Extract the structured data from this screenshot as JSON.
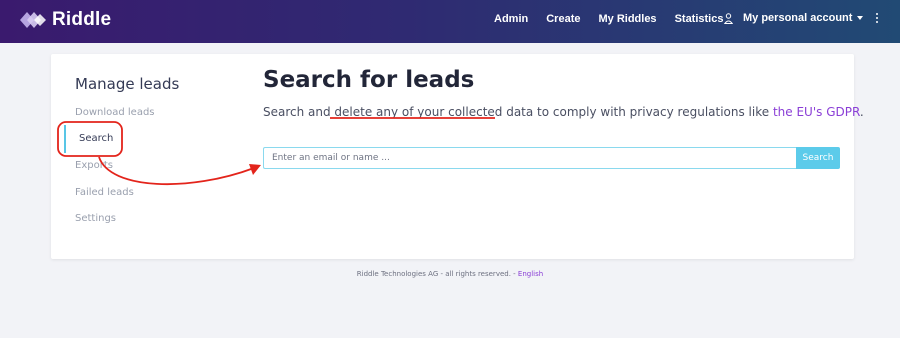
{
  "brand": {
    "name": "Riddle"
  },
  "nav": {
    "links": [
      "Admin",
      "Create",
      "My Riddles",
      "Statistics"
    ],
    "account_label": "My personal account"
  },
  "sidebar": {
    "title": "Manage leads",
    "items": [
      {
        "label": "Download leads"
      },
      {
        "label": "Search"
      },
      {
        "label": "Exports"
      },
      {
        "label": "Failed leads"
      },
      {
        "label": "Settings"
      }
    ],
    "active": "Search"
  },
  "main": {
    "title": "Search for leads",
    "description_prefix": "Search and delete any of your collected data to comply with privacy regulations like ",
    "description_link": "the EU's GDPR",
    "description_suffix": ".",
    "search": {
      "placeholder": "Enter an email or name ...",
      "value": "",
      "button_label": "Search"
    }
  },
  "footer": {
    "text": "Riddle Technologies AG - all rights reserved. - ",
    "language_link": "English"
  },
  "colors": {
    "nav_gradient_start": "#3a1a6e",
    "nav_gradient_end": "#214a74",
    "accent_cyan": "#5ccbea",
    "link_purple": "#8a3ed6",
    "annotation_red": "#e3241b"
  }
}
